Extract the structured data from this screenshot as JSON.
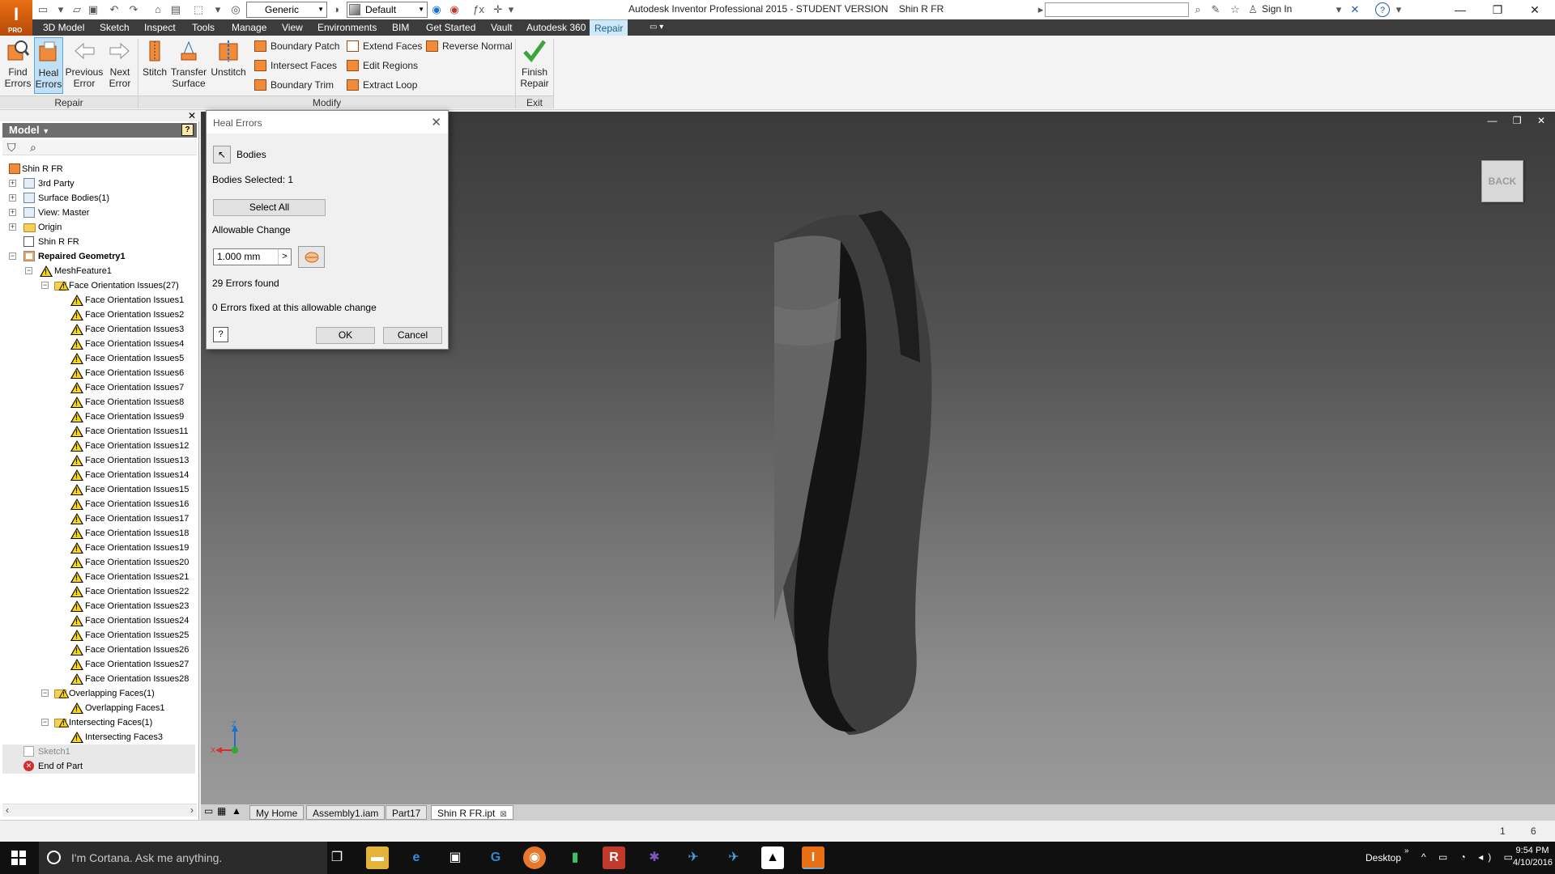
{
  "window": {
    "title": "Autodesk Inventor Professional 2015 - STUDENT VERSION    Shin R FR",
    "app_button": "I",
    "app_button_sub": "PRO",
    "material_combo": "Generic",
    "appearance_combo": "Default",
    "sign_in": "Sign In"
  },
  "menu_tabs": [
    "3D Model",
    "Sketch",
    "Inspect",
    "Tools",
    "Manage",
    "View",
    "Environments",
    "BIM",
    "Get Started",
    "Vault",
    "Autodesk 360",
    "Repair"
  ],
  "active_menu_tab": "Repair",
  "ribbon": {
    "repair_buttons": [
      {
        "label": "Find Errors",
        "l1": "Find",
        "l2": "Errors"
      },
      {
        "label": "Heal Errors",
        "l1": "Heal",
        "l2": "Errors"
      },
      {
        "label": "Previous Error",
        "l1": "Previous",
        "l2": "Error"
      },
      {
        "label": "Next Error",
        "l1": "Next",
        "l2": "Error"
      }
    ],
    "modify_buttons": [
      {
        "l1": "Stitch",
        "l2": ""
      },
      {
        "l1": "Transfer",
        "l2": "Surface"
      },
      {
        "l1": "Unstitch",
        "l2": ""
      }
    ],
    "modify_small": [
      "Boundary Patch",
      "Intersect Faces",
      "Boundary Trim",
      "Extend Faces",
      "Edit Regions",
      "Extract Loop",
      "Reverse Normal"
    ],
    "finish": {
      "l1": "Finish",
      "l2": "Repair"
    },
    "panels": {
      "repair": "Repair",
      "modify": "Modify",
      "exit": "Exit"
    }
  },
  "browser": {
    "title": "Model",
    "tree": [
      {
        "label": "Shin R FR",
        "level": 0,
        "icon": "part-icon",
        "toggle": ""
      },
      {
        "label": "3rd Party",
        "level": 1,
        "icon": "third-party-icon",
        "toggle": "+"
      },
      {
        "label": "Surface Bodies(1)",
        "level": 1,
        "icon": "surface-bodies-icon",
        "toggle": "+"
      },
      {
        "label": "View: Master",
        "level": 1,
        "icon": "view-icon",
        "toggle": "+"
      },
      {
        "label": "Origin",
        "level": 1,
        "icon": "folder-icon",
        "toggle": "+"
      },
      {
        "label": "Shin R FR",
        "level": 1,
        "icon": "mesh-icon",
        "toggle": ""
      },
      {
        "label": "Repaired Geometry1",
        "level": 1,
        "icon": "repair-icon",
        "toggle": "-",
        "bold": true
      },
      {
        "label": "MeshFeature1",
        "level": 2,
        "icon": "warning-icon",
        "toggle": "-"
      },
      {
        "label": "Face Orientation Issues(27)",
        "level": 3,
        "icon": "warning-folder-icon",
        "toggle": "-"
      },
      {
        "label": "Face Orientation Issues1",
        "level": 4,
        "icon": "warning-icon"
      },
      {
        "label": "Face Orientation Issues2",
        "level": 4,
        "icon": "warning-icon"
      },
      {
        "label": "Face Orientation Issues3",
        "level": 4,
        "icon": "warning-icon"
      },
      {
        "label": "Face Orientation Issues4",
        "level": 4,
        "icon": "warning-icon"
      },
      {
        "label": "Face Orientation Issues5",
        "level": 4,
        "icon": "warning-icon"
      },
      {
        "label": "Face Orientation Issues6",
        "level": 4,
        "icon": "warning-icon"
      },
      {
        "label": "Face Orientation Issues7",
        "level": 4,
        "icon": "warning-icon"
      },
      {
        "label": "Face Orientation Issues8",
        "level": 4,
        "icon": "warning-icon"
      },
      {
        "label": "Face Orientation Issues9",
        "level": 4,
        "icon": "warning-icon"
      },
      {
        "label": "Face Orientation Issues11",
        "level": 4,
        "icon": "warning-icon"
      },
      {
        "label": "Face Orientation Issues12",
        "level": 4,
        "icon": "warning-icon"
      },
      {
        "label": "Face Orientation Issues13",
        "level": 4,
        "icon": "warning-icon"
      },
      {
        "label": "Face Orientation Issues14",
        "level": 4,
        "icon": "warning-icon"
      },
      {
        "label": "Face Orientation Issues15",
        "level": 4,
        "icon": "warning-icon"
      },
      {
        "label": "Face Orientation Issues16",
        "level": 4,
        "icon": "warning-icon"
      },
      {
        "label": "Face Orientation Issues17",
        "level": 4,
        "icon": "warning-icon"
      },
      {
        "label": "Face Orientation Issues18",
        "level": 4,
        "icon": "warning-icon"
      },
      {
        "label": "Face Orientation Issues19",
        "level": 4,
        "icon": "warning-icon"
      },
      {
        "label": "Face Orientation Issues20",
        "level": 4,
        "icon": "warning-icon"
      },
      {
        "label": "Face Orientation Issues21",
        "level": 4,
        "icon": "warning-icon"
      },
      {
        "label": "Face Orientation Issues22",
        "level": 4,
        "icon": "warning-icon"
      },
      {
        "label": "Face Orientation Issues23",
        "level": 4,
        "icon": "warning-icon"
      },
      {
        "label": "Face Orientation Issues24",
        "level": 4,
        "icon": "warning-icon"
      },
      {
        "label": "Face Orientation Issues25",
        "level": 4,
        "icon": "warning-icon"
      },
      {
        "label": "Face Orientation Issues26",
        "level": 4,
        "icon": "warning-icon"
      },
      {
        "label": "Face Orientation Issues27",
        "level": 4,
        "icon": "warning-icon"
      },
      {
        "label": "Face Orientation Issues28",
        "level": 4,
        "icon": "warning-icon"
      },
      {
        "label": "Overlapping Faces(1)",
        "level": 3,
        "icon": "warning-folder-icon",
        "toggle": "-"
      },
      {
        "label": "Overlapping Faces1",
        "level": 4,
        "icon": "warning-icon"
      },
      {
        "label": "Intersecting Faces(1)",
        "level": 3,
        "icon": "warning-folder-icon",
        "toggle": "-"
      },
      {
        "label": "Intersecting Faces3",
        "level": 4,
        "icon": "warning-icon"
      },
      {
        "label": "Sketch1",
        "level": 1,
        "icon": "sketch-icon",
        "grey": true
      },
      {
        "label": "End of Part",
        "level": 1,
        "icon": "end-of-part-icon"
      }
    ]
  },
  "viewcube": {
    "label": "BACK"
  },
  "triad": {
    "z": "Z",
    "x": "X"
  },
  "doc_tabs": [
    "My Home",
    "Assembly1.iam",
    "Part17",
    "Shin R FR.ipt"
  ],
  "active_doc_tab": "Shin R FR.ipt",
  "status": {
    "count1": "1",
    "count2": "6"
  },
  "dialog": {
    "title": "Heal Errors",
    "bodies_label": "Bodies",
    "bodies_selected": "Bodies Selected: 1",
    "select_all": "Select All",
    "allowable_change_label": "Allowable Change",
    "allowable_change_value": "1.000 mm",
    "errors_found": "29 Errors found",
    "errors_fixed": "0 Errors fixed at this allowable change",
    "ok": "OK",
    "cancel": "Cancel"
  },
  "taskbar": {
    "cortana_placeholder": "I'm Cortana. Ask me anything.",
    "desktop_label": "Desktop",
    "time": "9:54 PM",
    "date": "4/10/2016"
  },
  "colors": {
    "accent": "#1d5e8c",
    "warning": "#ffd800",
    "viewport_top": "#3a3a3a",
    "viewport_bottom": "#9a9a9a"
  }
}
